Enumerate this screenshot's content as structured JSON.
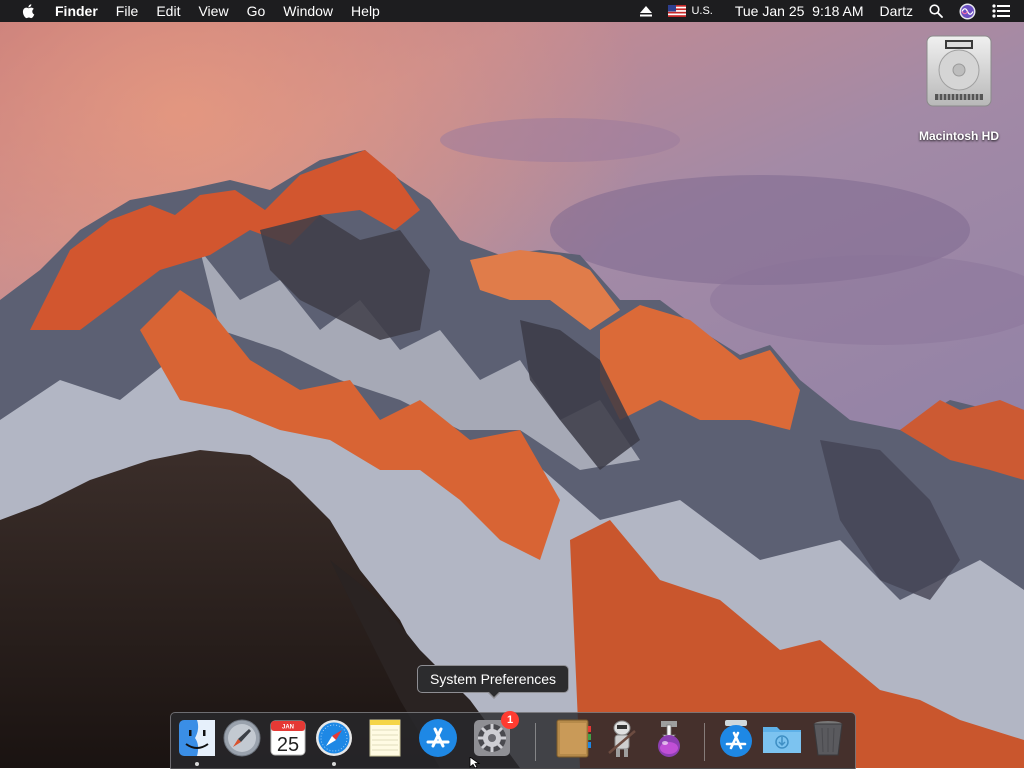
{
  "menubar": {
    "app_name": "Finder",
    "menus": [
      "File",
      "Edit",
      "View",
      "Go",
      "Window",
      "Help"
    ],
    "status": {
      "input_source": "U.S.",
      "datetime": "Tue Jan 25  9:18 AM",
      "user": "Dartz"
    }
  },
  "desktop": {
    "icons": [
      {
        "label": "Macintosh HD",
        "icon": "hard-drive-icon"
      }
    ]
  },
  "tooltip": {
    "text": "System Preferences"
  },
  "dock": {
    "apps": [
      {
        "name": "Finder",
        "icon": "finder-icon",
        "running": true
      },
      {
        "name": "Launchpad",
        "icon": "launchpad-icon",
        "running": false
      },
      {
        "name": "Calendar",
        "icon": "calendar-icon",
        "running": false,
        "month": "JAN",
        "day": "25"
      },
      {
        "name": "Safari",
        "icon": "safari-icon",
        "running": true
      },
      {
        "name": "Notes",
        "icon": "notes-icon",
        "running": false
      },
      {
        "name": "App Store",
        "icon": "app-store-icon",
        "running": false
      },
      {
        "name": "System Preferences",
        "icon": "system-preferences-icon",
        "running": false,
        "badge": "1"
      },
      {
        "name": "Contacts",
        "icon": "contacts-icon",
        "running": false
      },
      {
        "name": "Automator",
        "icon": "automator-icon",
        "running": false
      },
      {
        "name": "Installer",
        "icon": "installer-icon",
        "running": false
      },
      {
        "name": "App Store Download",
        "icon": "app-store-icon",
        "running": false
      },
      {
        "name": "Downloads",
        "icon": "downloads-folder-icon",
        "running": false
      },
      {
        "name": "Trash",
        "icon": "trash-icon",
        "running": false
      }
    ]
  }
}
